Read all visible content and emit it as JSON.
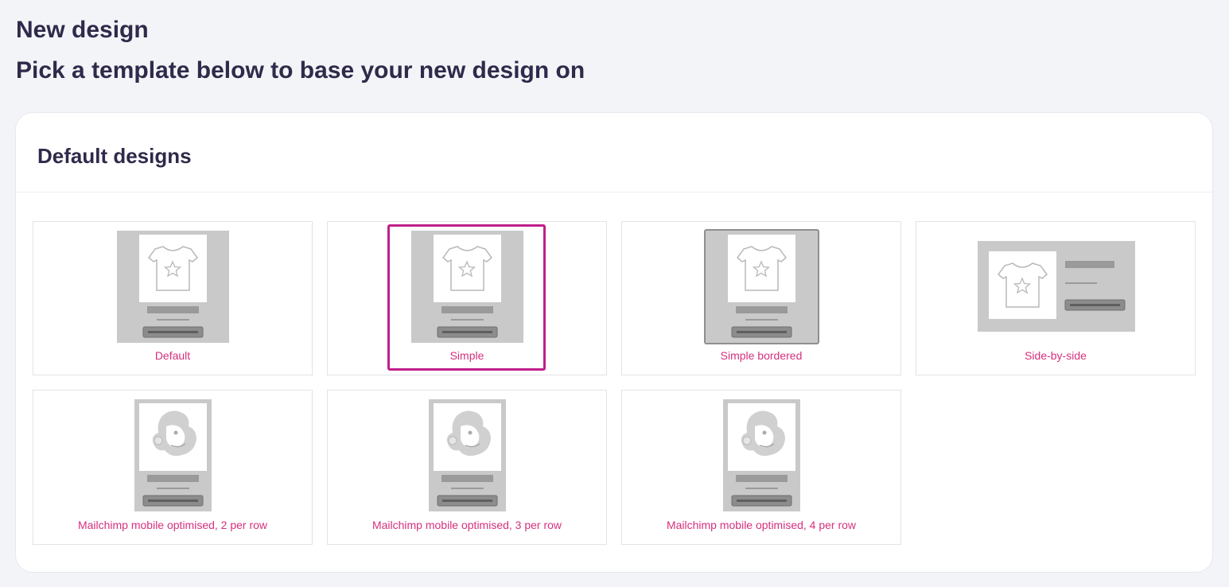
{
  "page": {
    "title": "New design",
    "subtitle": "Pick a template below to base your new design on"
  },
  "panel": {
    "title": "Default designs"
  },
  "templates": [
    {
      "label": "Default",
      "thumbnail": "tshirt-square-icon",
      "selected": false
    },
    {
      "label": "Simple",
      "thumbnail": "tshirt-square-icon",
      "selected": true
    },
    {
      "label": "Simple bordered",
      "thumbnail": "tshirt-bordered-icon",
      "selected": false
    },
    {
      "label": "Side-by-side",
      "thumbnail": "tshirt-side-icon",
      "selected": false
    },
    {
      "label": "Mailchimp mobile optimised, 2 per row",
      "thumbnail": "mailchimp-mobile-icon",
      "selected": false
    },
    {
      "label": "Mailchimp mobile optimised, 3 per row",
      "thumbnail": "mailchimp-mobile-icon",
      "selected": false
    },
    {
      "label": "Mailchimp mobile optimised, 4 per row",
      "thumbnail": "mailchimp-mobile-icon",
      "selected": false
    }
  ],
  "colors": {
    "accent": "#c01f8b",
    "label": "#d6307d",
    "heading": "#2f2a4a",
    "thumb_bg": "#c9c9c9"
  }
}
